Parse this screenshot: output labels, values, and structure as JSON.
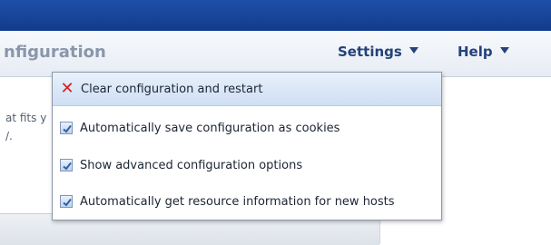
{
  "header": {
    "title_fragment": "nfiguration",
    "menus": {
      "settings": "Settings",
      "help": "Help"
    }
  },
  "content": {
    "partial_line_1": "at fits y",
    "partial_line_2": "/."
  },
  "settings_menu": {
    "items": [
      {
        "label": "Clear configuration and restart",
        "icon": "close-icon"
      },
      {
        "label": "Automatically save configuration as cookies",
        "checked": true
      },
      {
        "label": "Show advanced configuration options",
        "checked": true
      },
      {
        "label": "Automatically get resource information for new hosts",
        "checked": true
      }
    ]
  },
  "colors": {
    "top_bar": "#1f4fa8",
    "menu_text": "#24427a",
    "title_text": "#8a96ab",
    "highlight_row": "#dbe7f7",
    "close_icon": "#d02020"
  }
}
